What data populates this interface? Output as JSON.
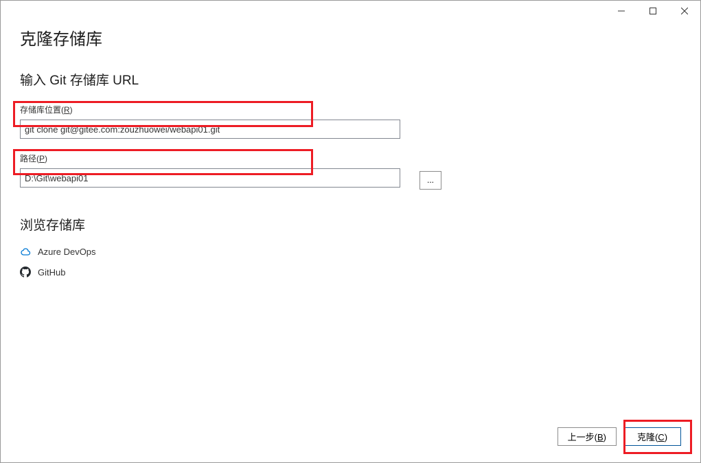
{
  "titlebar": {
    "minimize": "—",
    "maximize": "☐",
    "close": "✕"
  },
  "page": {
    "title": "克隆存储库",
    "subtitle": "输入 Git 存储库 URL"
  },
  "fields": {
    "repo_location_label": "存储库位置(",
    "repo_location_key": "R",
    "repo_location_label_end": ")",
    "repo_location_value": "git clone git@gitee.com:zouzhuowei/webapi01.git",
    "path_label": "路径(",
    "path_key": "P",
    "path_label_end": ")",
    "path_value": "D:\\Git\\webapi01",
    "browse_label": "..."
  },
  "browse": {
    "title": "浏览存储库",
    "providers": [
      {
        "icon": "cloud",
        "label": "Azure DevOps"
      },
      {
        "icon": "github",
        "label": "GitHub"
      }
    ]
  },
  "footer": {
    "back_label": "上一步(",
    "back_key": "B",
    "back_label_end": ")",
    "clone_label": "克隆(",
    "clone_key": "C",
    "clone_label_end": ")"
  }
}
